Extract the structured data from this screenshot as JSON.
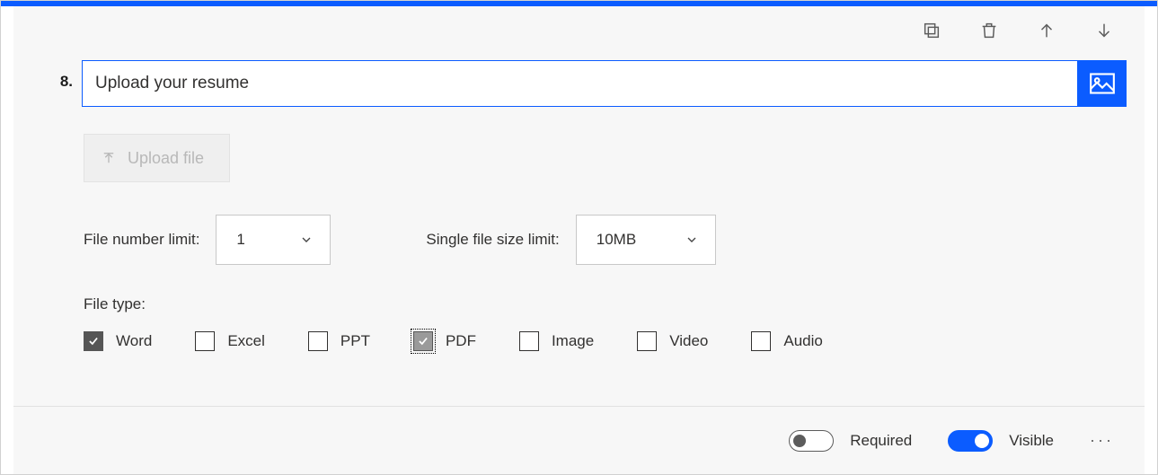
{
  "questionNumber": "8.",
  "questionText": "Upload your resume",
  "uploadLabel": "Upload file",
  "fileNumber": {
    "label": "File number limit:",
    "value": "1"
  },
  "fileSize": {
    "label": "Single file size limit:",
    "value": "10MB"
  },
  "fileTypeLabel": "File type:",
  "fileTypes": [
    {
      "label": "Word",
      "checked": true,
      "focus": false
    },
    {
      "label": "Excel",
      "checked": false,
      "focus": false
    },
    {
      "label": "PPT",
      "checked": false,
      "focus": false
    },
    {
      "label": "PDF",
      "checked": true,
      "focus": true
    },
    {
      "label": "Image",
      "checked": false,
      "focus": false
    },
    {
      "label": "Video",
      "checked": false,
      "focus": false
    },
    {
      "label": "Audio",
      "checked": false,
      "focus": false
    }
  ],
  "footer": {
    "requiredLabel": "Required",
    "requiredOn": false,
    "visibleLabel": "Visible",
    "visibleOn": true
  }
}
